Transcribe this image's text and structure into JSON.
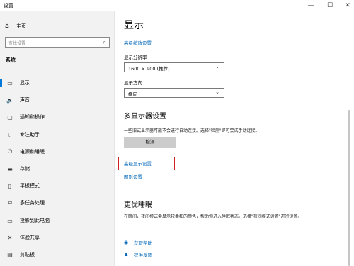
{
  "window": {
    "title": "设置",
    "minimize": "—",
    "maximize": "☐",
    "close": "✕"
  },
  "sidebar": {
    "home_label": "主页",
    "search_placeholder": "查找设置",
    "section_title": "系统",
    "items": [
      {
        "label": "显示",
        "icon": "monitor-icon",
        "glyph": "▭",
        "active": true
      },
      {
        "label": "声音",
        "icon": "speaker-icon",
        "glyph": "🔈",
        "active": false
      },
      {
        "label": "通知和操作",
        "icon": "notification-icon",
        "glyph": "▢",
        "active": false
      },
      {
        "label": "专注助手",
        "icon": "moon-icon",
        "glyph": "☾",
        "active": false
      },
      {
        "label": "电源和睡眠",
        "icon": "power-icon",
        "glyph": "⏻",
        "active": false
      },
      {
        "label": "存储",
        "icon": "storage-icon",
        "glyph": "▬",
        "active": false
      },
      {
        "label": "平板模式",
        "icon": "tablet-icon",
        "glyph": "▯",
        "active": false
      },
      {
        "label": "多任务处理",
        "icon": "multitask-icon",
        "glyph": "⧉",
        "active": false
      },
      {
        "label": "投影到此电脑",
        "icon": "project-icon",
        "glyph": "▭",
        "active": false
      },
      {
        "label": "体验共享",
        "icon": "share-icon",
        "glyph": "✕",
        "active": false
      },
      {
        "label": "剪贴板",
        "icon": "clipboard-icon",
        "glyph": "▤",
        "active": false
      }
    ]
  },
  "main": {
    "title": "显示",
    "advanced_scaling_link": "高级缩放设置",
    "resolution_label": "显示分辨率",
    "resolution_value": "1600 × 900 (推荐)",
    "orientation_label": "显示方向",
    "orientation_value": "横向",
    "multi_display_title": "多显示器设置",
    "multi_display_desc": "一些旧式显示器可能不会进行自动连接。选择\"检测\"即可尝试手动连接。",
    "detect_button": "检测",
    "advanced_display_link": "高级显示设置",
    "graphics_link": "图形设置",
    "sleep_title": "更优睡眠",
    "sleep_desc": "在晚间，夜间模式会显示较柔和的颜色，帮助你进入睡眠状态。选择\"夜间模式设置\"进行设置。",
    "help_link": "获取帮助",
    "feedback_link": "提供反馈"
  },
  "colors": {
    "accent": "#0078d7",
    "link": "#0066b8",
    "highlight_border": "#cc2222"
  }
}
